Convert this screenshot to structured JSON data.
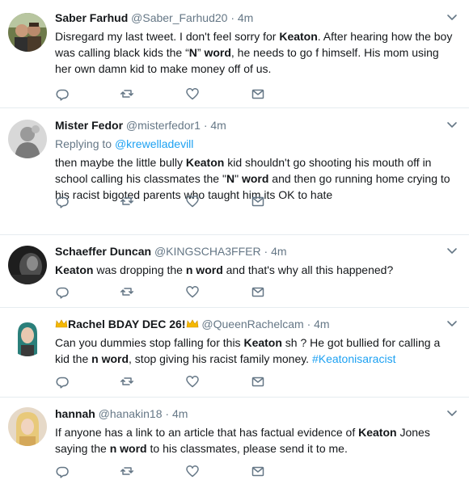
{
  "tweets": [
    {
      "name": "Saber Farhud",
      "handle": "@Saber_Farhud20",
      "separator": "·",
      "time": "4m",
      "avatar": "avatar-two-men-outdoors",
      "segments": [
        {
          "t": "Disregard my last tweet. I don't feel sorry for ",
          "b": false
        },
        {
          "t": "Keaton",
          "b": true
        },
        {
          "t": ". After hearing how the boy was calling black kids the “",
          "b": false
        },
        {
          "t": "N",
          "b": true
        },
        {
          "t": "” ",
          "b": false
        },
        {
          "t": "word",
          "b": true
        },
        {
          "t": ", he needs to go f himself. His mom using her own damn kid to make money off of us.",
          "b": false
        }
      ]
    },
    {
      "name": "Mister Fedor",
      "handle": "@misterfedor1",
      "separator": "·",
      "time": "4m",
      "avatar": "avatar-grayscale-figure",
      "reply_prefix": "Replying to ",
      "reply_link": "@krewelladevill",
      "segments": [
        {
          "t": "then maybe the little bully ",
          "b": false
        },
        {
          "t": "Keaton",
          "b": true
        },
        {
          "t": " kid shouldn't go shooting his mouth off in school calling his classmates the \"",
          "b": false
        },
        {
          "t": "N",
          "b": true
        },
        {
          "t": "\" ",
          "b": false
        },
        {
          "t": "word",
          "b": true
        },
        {
          "t": " and then go running home crying to his racist bigoted parents who taught him its OK to hate",
          "b": false
        }
      ]
    },
    {
      "name": "Schaeffer Duncan",
      "handle": "@KINGSCHA3FFER",
      "separator": "·",
      "time": "4m",
      "avatar": "avatar-dark-profile",
      "segments": [
        {
          "t": "Keaton",
          "b": true
        },
        {
          "t": " was dropping the ",
          "b": false
        },
        {
          "t": "n word",
          "b": true
        },
        {
          "t": " and that's why all this happened?",
          "b": false
        }
      ]
    },
    {
      "name_prefix_icon": "crown-icon",
      "name": "Rachel BDAY DEC 26!",
      "name_suffix_icon": "crown-icon",
      "handle": "@QueenRachelcam",
      "separator": "·",
      "time": "4m",
      "avatar": "avatar-woman-teal-hair",
      "segments": [
        {
          "t": "Can you dummies stop falling for this ",
          "b": false
        },
        {
          "t": "Keaton",
          "b": true
        },
        {
          "t": " sh  ? He got bullied for calling a kid the ",
          "b": false
        },
        {
          "t": "n word",
          "b": true
        },
        {
          "t": ", stop giving his racist family money. ",
          "b": false
        },
        {
          "t": "#Keatonisaracist",
          "b": false,
          "link": true
        }
      ]
    },
    {
      "name": "hannah",
      "handle": "@hanakin18",
      "separator": "·",
      "time": "4m",
      "avatar": "avatar-blonde-woman",
      "segments": [
        {
          "t": "If anyone has a link to an article that has factual evidence of ",
          "b": false
        },
        {
          "t": "Keaton",
          "b": true
        },
        {
          "t": " Jones saying the ",
          "b": false
        },
        {
          "t": "n word",
          "b": true
        },
        {
          "t": " to his classmates, please send it to me.",
          "b": false
        }
      ]
    }
  ],
  "actions": [
    "reply-icon",
    "retweet-icon",
    "like-icon",
    "message-icon"
  ],
  "colors": {
    "link": "#1da1f2",
    "muted": "#657786",
    "text": "#14171a",
    "divider": "#e6ecf0",
    "crown": "#f5b800"
  }
}
